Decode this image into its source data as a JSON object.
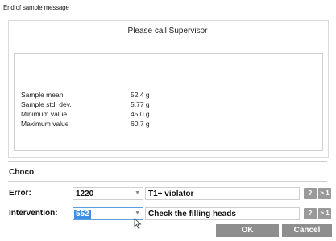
{
  "window": {
    "title": "End of sample message"
  },
  "message": "Please call Supervisor",
  "stats": [
    {
      "label": "Sample mean",
      "value": "52.4 g"
    },
    {
      "label": "Sample std. dev.",
      "value": "5.77 g"
    },
    {
      "label": "Minimum value",
      "value": "45.0 g"
    },
    {
      "label": "Maximum value",
      "value": "60.7 g"
    }
  ],
  "product": "Choco",
  "error": {
    "label": "Error:",
    "code": "1220",
    "description": "T1+ violator",
    "help": "?",
    "next": "> 1"
  },
  "intervention": {
    "label": "Intervention:",
    "code": "552",
    "description": "Check the filling heads",
    "help": "?",
    "next": "> 1"
  },
  "buttons": {
    "ok": "OK",
    "cancel": "Cancel"
  },
  "icons": {
    "dropdown": "chevron-down-icon",
    "cursor": "mouse-pointer-icon"
  },
  "colors": {
    "selection": "#3d8ee6",
    "button": "#8e8e8e"
  }
}
